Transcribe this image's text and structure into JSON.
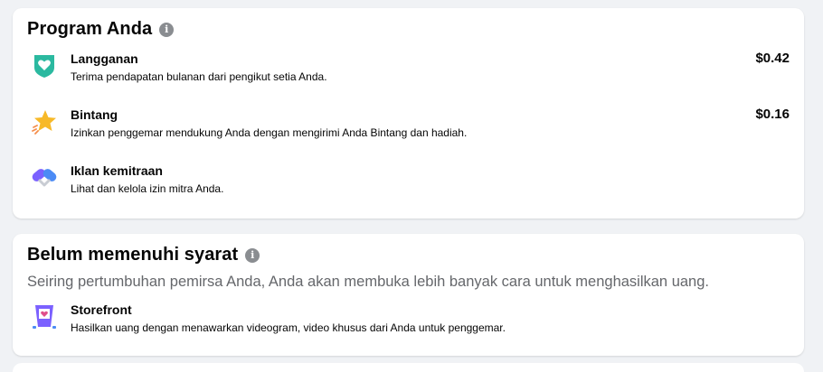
{
  "programs": {
    "title": "Program Anda",
    "items": [
      {
        "name": "Langganan",
        "description": "Terima pendapatan bulanan dari pengikut setia Anda.",
        "amount": "$0.42",
        "icon": "subscription-heart-icon"
      },
      {
        "name": "Bintang",
        "description": "Izinkan penggemar mendukung Anda dengan mengirimi Anda Bintang dan hadiah.",
        "amount": "$0.16",
        "icon": "star-icon"
      },
      {
        "name": "Iklan kemitraan",
        "description": "Lihat dan kelola izin mitra Anda.",
        "icon": "partnership-ads-icon"
      }
    ]
  },
  "not_eligible": {
    "title": "Belum memenuhi syarat",
    "subtitle": "Seiring pertumbuhan pemirsa Anda, Anda akan membuka lebih banyak cara untuk menghasilkan uang.",
    "items": [
      {
        "name": "Storefront",
        "description": "Hasilkan uang dengan menawarkan videogram, video khusus dari Anda untuk penggemar.",
        "icon": "storefront-icon"
      }
    ]
  },
  "colors": {
    "background": "#f0f2f5",
    "card": "#ffffff",
    "teal": "#2bb9a0",
    "star": "#f7b928",
    "purple": "#7b61ff"
  }
}
